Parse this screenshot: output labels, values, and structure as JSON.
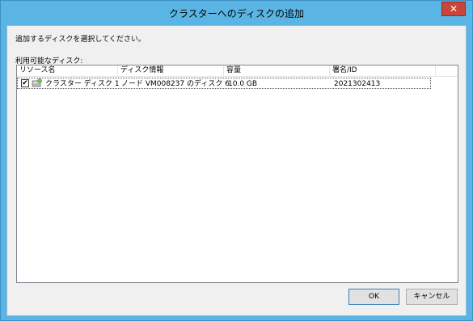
{
  "window": {
    "title": "クラスターへのディスクの追加",
    "close_symbol": "✕"
  },
  "dialog": {
    "instruction": "追加するディスクを選択してください。",
    "available_label": "利用可能なディスク:"
  },
  "table": {
    "columns": [
      "リソース名",
      "ディスク情報",
      "容量",
      "署名/ID"
    ],
    "rows": [
      {
        "checked": true,
        "check_symbol": "✔",
        "icon": "disk-icon",
        "resource_name": "クラスター ディスク 1",
        "disk_info": "ノード VM008237 のディスク 6",
        "capacity": "10.0 GB",
        "signature": "2021302413"
      }
    ]
  },
  "buttons": {
    "ok": "OK",
    "cancel": "キャンセル"
  },
  "colors": {
    "titlebar": "#5ab5e4",
    "close_button": "#c7453a",
    "client_background": "#f0f0f0"
  }
}
